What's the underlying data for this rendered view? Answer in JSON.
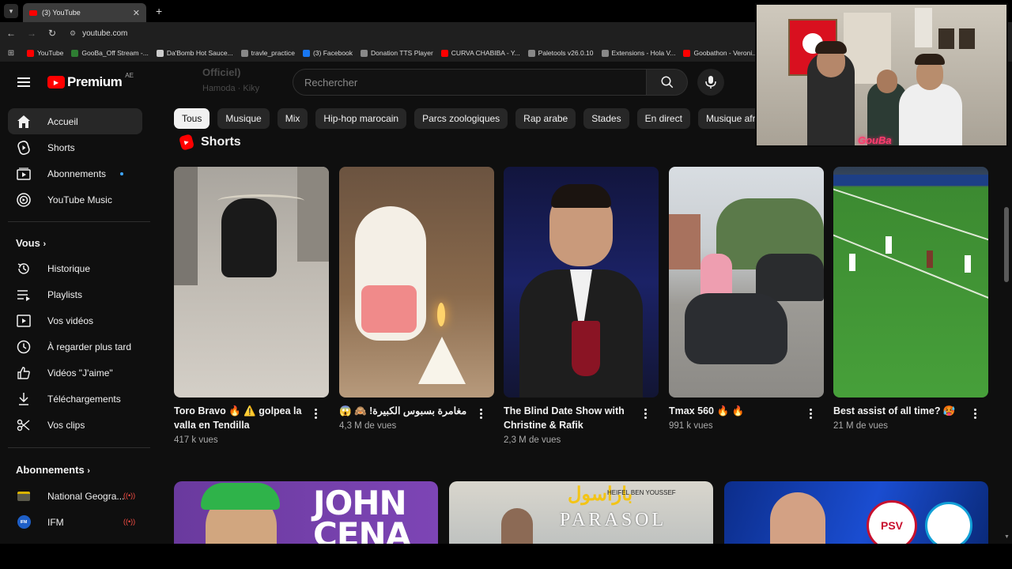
{
  "browser": {
    "tab_title": "(3) YouTube",
    "url": "youtube.com",
    "bookmarks": [
      {
        "label": "YouTube",
        "color": "#ff0000"
      },
      {
        "label": "GooBa_Off Stream -...",
        "color": "#2e7d32"
      },
      {
        "label": "Da'Bomb Hot Sauce...",
        "color": "#cccccc"
      },
      {
        "label": "travle_practice",
        "color": "#888888"
      },
      {
        "label": "(3) Facebook",
        "color": "#1877f2"
      },
      {
        "label": "Donation TTS Player",
        "color": "#888888"
      },
      {
        "label": "CURVA CHABIBA - Y...",
        "color": "#ff0000"
      },
      {
        "label": "Paletools v26.0.10",
        "color": "#888888"
      },
      {
        "label": "Extensions - Hola V...",
        "color": "#888888"
      },
      {
        "label": "Goobathon - Veroni...",
        "color": "#ff0000"
      }
    ]
  },
  "masthead": {
    "logo_text": "Premium",
    "country_code": "AE",
    "search_placeholder": "Rechercher",
    "ghost_title": "Officiel)",
    "ghost_sub": "Hamoda · Kiky"
  },
  "sidebar": {
    "main": [
      {
        "label": "Accueil",
        "icon": "home-icon"
      },
      {
        "label": "Shorts",
        "icon": "shorts-icon"
      },
      {
        "label": "Abonnements",
        "icon": "subscriptions-icon"
      },
      {
        "label": "YouTube Music",
        "icon": "youtube-music-icon"
      }
    ],
    "you_heading": "Vous",
    "you": [
      {
        "label": "Historique",
        "icon": "history-icon"
      },
      {
        "label": "Playlists",
        "icon": "playlists-icon"
      },
      {
        "label": "Vos vidéos",
        "icon": "your-videos-icon"
      },
      {
        "label": "À regarder plus tard",
        "icon": "watch-later-icon"
      },
      {
        "label": "Vidéos \"J'aime\"",
        "icon": "liked-icon"
      },
      {
        "label": "Téléchargements",
        "icon": "downloads-icon"
      },
      {
        "label": "Vos clips",
        "icon": "clips-icon"
      }
    ],
    "subs_heading": "Abonnements",
    "subs": [
      {
        "label": "National Geogra..."
      },
      {
        "label": "IFM"
      }
    ]
  },
  "chips": [
    "Tous",
    "Musique",
    "Mix",
    "Hip-hop marocain",
    "Parcs zoologiques",
    "Rap arabe",
    "Stades",
    "En direct",
    "Musique afric"
  ],
  "shorts_title": "Shorts",
  "shorts": [
    {
      "title": "Toro Bravo 🔥 ⚠️ golpea la valla en Tendilla",
      "views": "417 k vues"
    },
    {
      "title": "مغامرة بسبوس الكبيرة! 🙈 😱",
      "views": "4,3 M de vues"
    },
    {
      "title": "The Blind Date Show with Christine & Rafik",
      "views": "2,3 M de vues"
    },
    {
      "title": "Tmax 560 🔥 🔥",
      "views": "991 k vues"
    },
    {
      "title": "Best assist of all time? 🥵",
      "views": "21 M de vues"
    }
  ],
  "videos": [
    {
      "thumb_text": "JOHN CENA"
    },
    {
      "thumb_text": "PARASOL",
      "thumb_sub": "باراسول",
      "thumb_credit": "HEIFEL BEN YOUSSEF"
    },
    {
      "thumb_text": "PSV"
    }
  ],
  "pip": {
    "neon_text": "GouBa"
  }
}
